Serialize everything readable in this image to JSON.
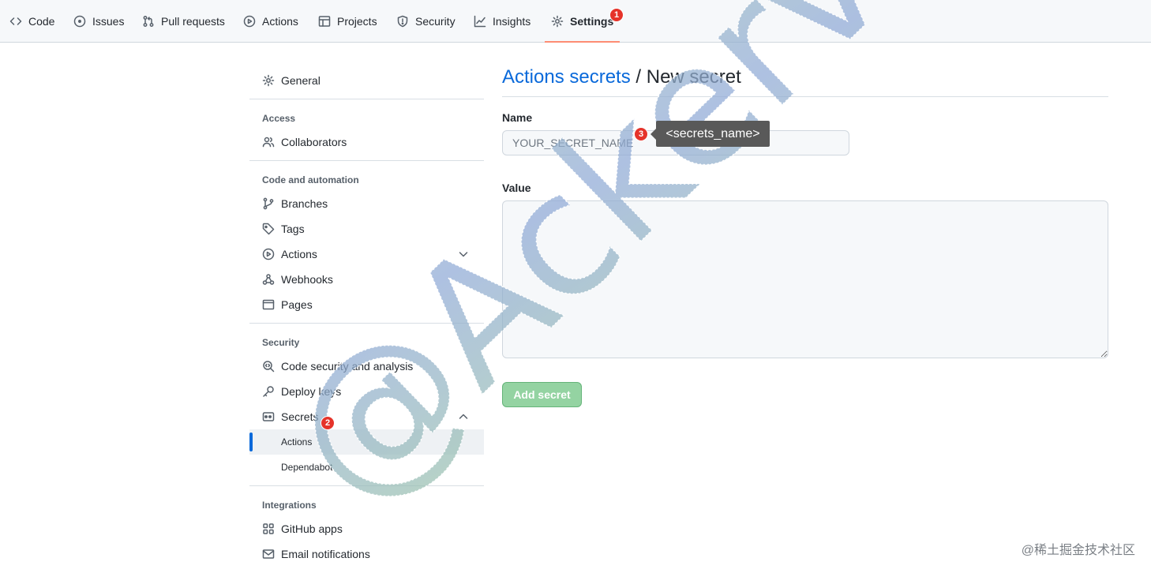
{
  "repo_nav": {
    "tabs": [
      {
        "label": "Code",
        "icon": "code-icon"
      },
      {
        "label": "Issues",
        "icon": "issue-opened-icon"
      },
      {
        "label": "Pull requests",
        "icon": "git-pull-request-icon"
      },
      {
        "label": "Actions",
        "icon": "play-icon"
      },
      {
        "label": "Projects",
        "icon": "table-icon"
      },
      {
        "label": "Security",
        "icon": "shield-icon"
      },
      {
        "label": "Insights",
        "icon": "graph-icon"
      },
      {
        "label": "Settings",
        "icon": "gear-icon",
        "active": true
      }
    ]
  },
  "annotations": {
    "step1": "1",
    "step2": "2",
    "step3": "3",
    "tooltip": "<secrets_name>",
    "marker_color": "#e5332a"
  },
  "sidebar": {
    "general": "General",
    "access_heading": "Access",
    "collaborators": "Collaborators",
    "code_heading": "Code and automation",
    "branches": "Branches",
    "tags": "Tags",
    "actions": "Actions",
    "webhooks": "Webhooks",
    "pages": "Pages",
    "security_heading": "Security",
    "code_security": "Code security and analysis",
    "deploy_keys": "Deploy keys",
    "secrets": "Secrets",
    "secrets_actions": "Actions",
    "secrets_dependabot": "Dependabot",
    "integrations_heading": "Integrations",
    "github_apps": "GitHub apps",
    "email_notifications": "Email notifications"
  },
  "main": {
    "breadcrumb_link": "Actions secrets",
    "breadcrumb_sep": " / ",
    "title": "New secret",
    "name_label": "Name",
    "name_placeholder": "YOUR_SECRET_NAME",
    "name_value": "",
    "value_label": "Value",
    "value_value": "",
    "submit_label": "Add secret"
  },
  "watermark": {
    "text": "@Ackerven",
    "corner": "@稀土掘金技术社区"
  },
  "colors": {
    "link": "#0969da",
    "active_tab_underline": "#fd8c73",
    "button_disabled": "#94d3a2"
  }
}
